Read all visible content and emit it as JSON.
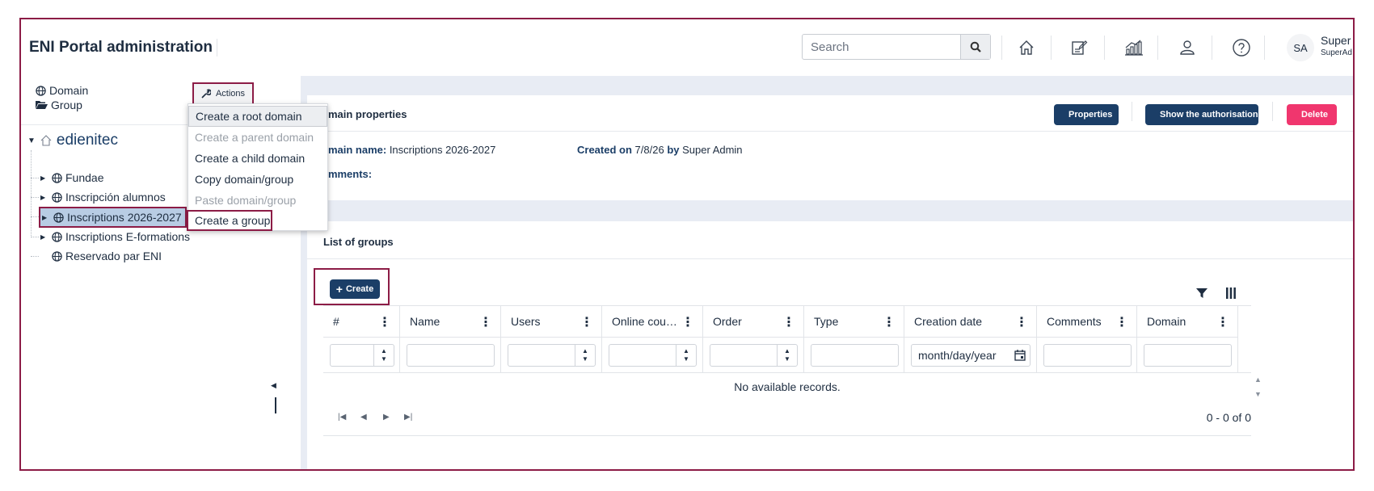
{
  "header": {
    "app_title": "ENI Portal administration",
    "search_placeholder": "Search",
    "nav_icons": [
      "home-icon",
      "edit-document-icon",
      "analytics-icon",
      "user-icon",
      "help-icon"
    ],
    "user": {
      "initials": "SA",
      "name": "Super A",
      "role": "SuperAd"
    }
  },
  "sidebar": {
    "legend": {
      "domain": "Domain",
      "group": "Group"
    },
    "actions_label": "Actions",
    "tree": {
      "root": "edienitec",
      "items": [
        {
          "label": "Fundae",
          "expandable": true
        },
        {
          "label": "Inscripción alumnos",
          "expandable": true
        },
        {
          "label": "Inscriptions 2026-2027",
          "expandable": true,
          "selected": true
        },
        {
          "label": "Inscriptions E-formations",
          "expandable": true
        },
        {
          "label": "Reservado par ENI",
          "expandable": false
        }
      ]
    },
    "menu": [
      {
        "label": "Create a root domain",
        "state": "hover"
      },
      {
        "label": "Create a parent domain",
        "state": "disabled"
      },
      {
        "label": "Create a child domain",
        "state": "enabled"
      },
      {
        "label": "Copy domain/group",
        "state": "enabled"
      },
      {
        "label": "Paste domain/group",
        "state": "disabled"
      },
      {
        "label": "Create a group",
        "state": "enabled"
      }
    ]
  },
  "domain_properties": {
    "title": "omain properties",
    "properties_btn": "Properties",
    "authorisations_btn": "Show the authorisations",
    "delete_btn": "Delete",
    "name_label": "omain name:",
    "name_value": "Inscriptions 2026-2027",
    "created_on_label": "Created on",
    "created_on_value": "7/8/26",
    "by_label": "by",
    "by_value": "Super Admin",
    "comments_label": "omments:"
  },
  "groups": {
    "title": "List of groups",
    "create_btn": "Create",
    "columns": [
      "#",
      "Name",
      "Users",
      "Online cou…",
      "Order",
      "Type",
      "Creation date",
      "Comments",
      "Domain"
    ],
    "date_placeholder": "month/day/year",
    "empty_text": "No available records.",
    "pager_info": "0 - 0 of 0"
  },
  "colors": {
    "primary": "#1b3e67",
    "danger": "#f0366e",
    "highlight_border": "#8c1c46",
    "selected_bg": "#b8cce4"
  }
}
